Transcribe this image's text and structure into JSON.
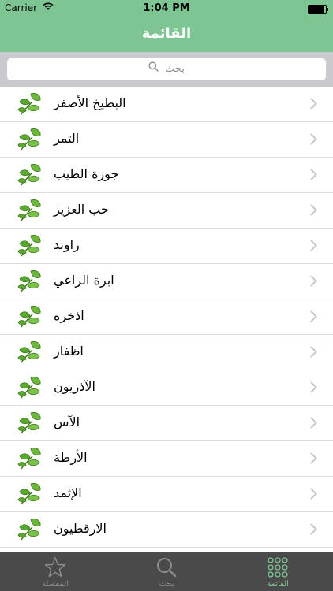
{
  "status_bar": {
    "carrier": "Carrier",
    "time": "1:04 PM",
    "battery_level": 0.95
  },
  "nav": {
    "title": "القائمة"
  },
  "search": {
    "placeholder": "بحث"
  },
  "list": {
    "items": [
      {
        "label": "البطيخ الأصفر"
      },
      {
        "label": "التمر"
      },
      {
        "label": "جوزة الطيب"
      },
      {
        "label": "حب العزيز"
      },
      {
        "label": "راوند"
      },
      {
        "label": "ابرة الراعي"
      },
      {
        "label": "اذخره"
      },
      {
        "label": "اظفار"
      },
      {
        "label": "الآذريون"
      },
      {
        "label": "الآس"
      },
      {
        "label": "الأرطة"
      },
      {
        "label": "الإثمد"
      },
      {
        "label": "الارقطيون"
      }
    ],
    "item_icon": "leaf-icon",
    "disclosure_icon": "chevron-right-icon"
  },
  "tab_bar": {
    "tabs": [
      {
        "label": "المفضلة",
        "icon": "star-icon"
      },
      {
        "label": "بحث",
        "icon": "search-icon"
      },
      {
        "label": "القائمة",
        "icon": "grid-icon"
      }
    ],
    "active_tab": "القائمة"
  },
  "colors": {
    "accent": "#7dc592",
    "tab_bar_bg": "#4a4a4a",
    "search_bg": "#c9c9ce",
    "leaf_green": "#5aa82e"
  }
}
